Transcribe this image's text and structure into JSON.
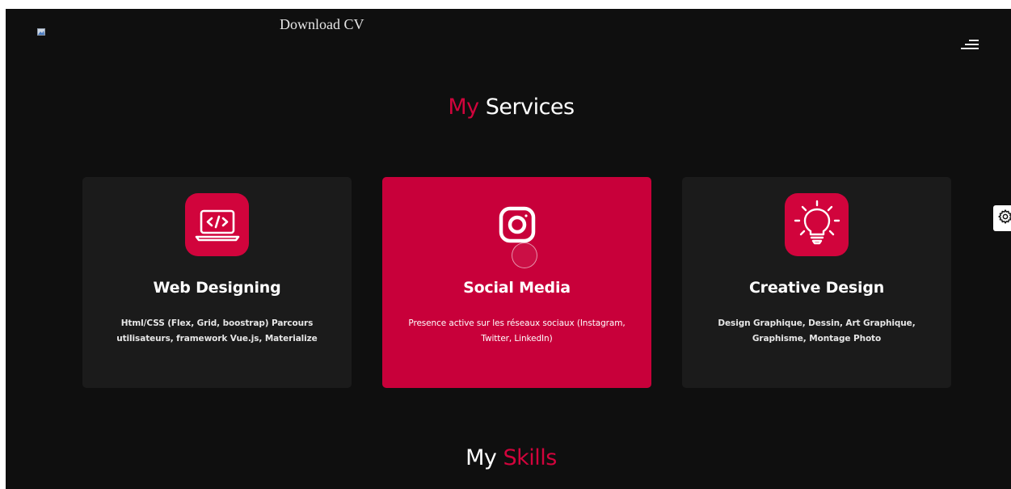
{
  "header": {
    "logo_alt": "logo",
    "download_cv_label": "Download CV",
    "menu_icon": "hamburger-menu-icon"
  },
  "services": {
    "title_part1": "My",
    "title_part2": "Services",
    "cards": [
      {
        "icon": "code-laptop-icon",
        "title": "Web Designing",
        "description": "Html/CSS (Flex, Grid, boostrap) Parcours utilisateurs, framework Vue.js, Materialize"
      },
      {
        "icon": "instagram-icon",
        "title": "Social Media",
        "description": "Presence active sur les réseaux sociaux (Instagram, Twitter, LinkedIn)"
      },
      {
        "icon": "lightbulb-icon",
        "title": "Creative Design",
        "description": "Design Graphique, Dessin, Art Graphique, Graphisme, Montage Photo"
      }
    ]
  },
  "skills": {
    "title_part1": "My",
    "title_part2": "Skills"
  },
  "settings": {
    "icon": "gear-icon"
  },
  "colors": {
    "accent": "#d1043c",
    "background": "#0f0f0f",
    "card_background": "#1b1b1b",
    "active_card": "#c8003a"
  }
}
